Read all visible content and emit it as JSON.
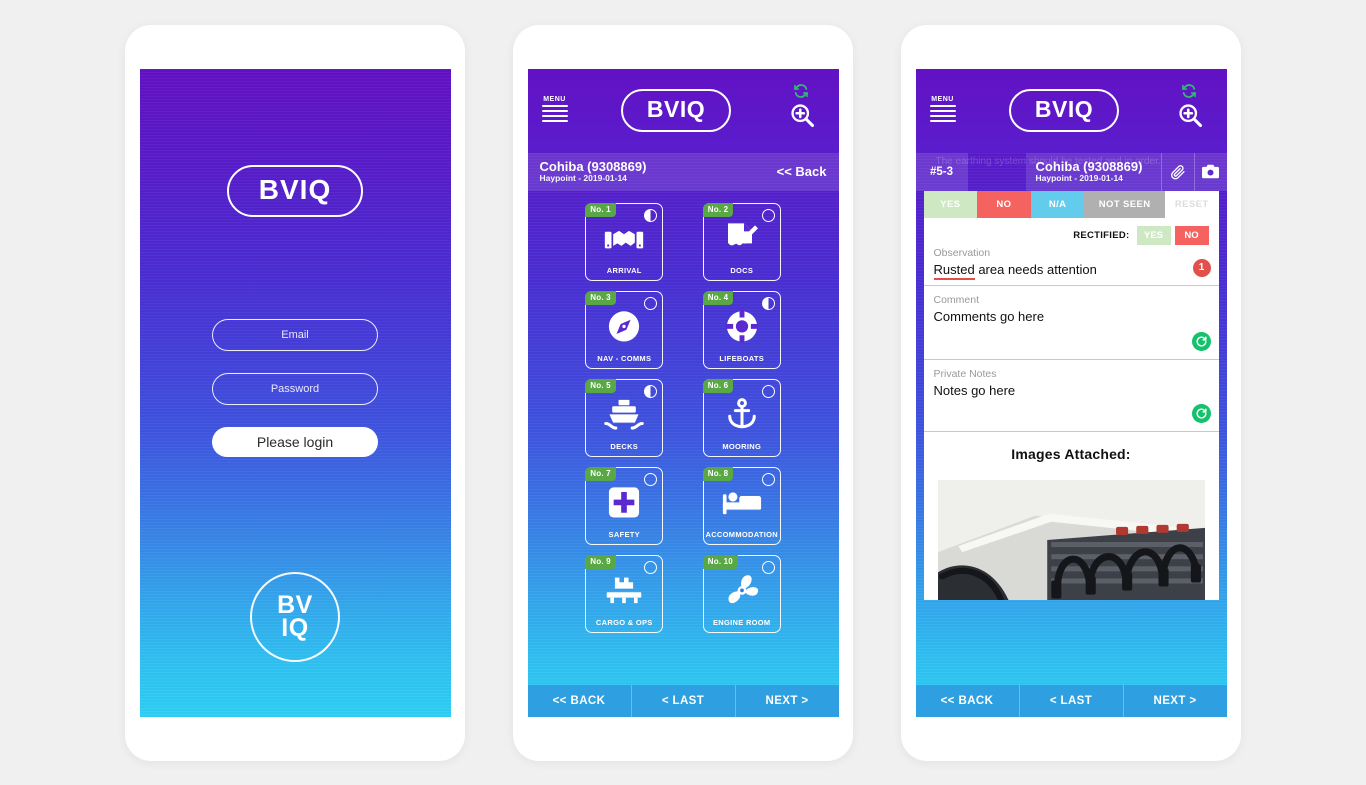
{
  "brand": {
    "wordmark": "BVIQ",
    "circle_line1": "BV",
    "circle_line2": "IQ"
  },
  "login": {
    "email_placeholder": "Email",
    "password_placeholder": "Password",
    "email_value": "",
    "password_value": "",
    "login_button": "Please login"
  },
  "header": {
    "menu_label": "MENU",
    "refresh_icon": "refresh-icon",
    "zoom_icon": "zoom-in-icon"
  },
  "vessel": {
    "name": "Cohiba (9308869)",
    "subtitle": "Haypoint - 2019-01-14",
    "back_label": "<< Back"
  },
  "grid": {
    "tiles": [
      {
        "no": "No. 1",
        "label": "ARRIVAL",
        "status": "half",
        "icon": "handshake-icon"
      },
      {
        "no": "No. 2",
        "label": "DOCS",
        "status": "empty",
        "icon": "document-signature-icon"
      },
      {
        "no": "No. 3",
        "label": "NAV - COMMS",
        "status": "empty",
        "icon": "compass-icon"
      },
      {
        "no": "No. 4",
        "label": "LIFEBOATS",
        "status": "half",
        "icon": "lifebuoy-icon"
      },
      {
        "no": "No. 5",
        "label": "DECKS",
        "status": "half",
        "icon": "ship-icon"
      },
      {
        "no": "No. 6",
        "label": "MOORING",
        "status": "empty",
        "icon": "anchor-icon"
      },
      {
        "no": "No. 7",
        "label": "SAFETY",
        "status": "empty",
        "icon": "first-aid-icon"
      },
      {
        "no": "No. 8",
        "label": "ACCOMMODATION",
        "status": "empty",
        "icon": "bed-icon"
      },
      {
        "no": "No. 9",
        "label": "CARGO & OPS",
        "status": "empty",
        "icon": "cargo-crane-icon"
      },
      {
        "no": "No. 10",
        "label": "ENGINE ROOM",
        "status": "empty",
        "icon": "propeller-icon"
      }
    ]
  },
  "bottom_nav": {
    "back": "<< BACK",
    "last": "< LAST",
    "next": "NEXT >"
  },
  "detail": {
    "item_code": "#5-3",
    "ghost_text": "The earthing system should be tested and in order.",
    "attach_icon": "paperclip-icon",
    "camera_icon": "camera-icon",
    "answers": [
      {
        "label": "YES",
        "state": "unselected"
      },
      {
        "label": "NO",
        "state": "selected"
      },
      {
        "label": "N/A",
        "state": "unselected"
      },
      {
        "label": "NOT SEEN",
        "state": "unselected"
      },
      {
        "label": "RESET",
        "state": "disabled"
      }
    ],
    "rectified_label": "RECTIFIED:",
    "rectified_yes": "YES",
    "rectified_no": "NO",
    "observation_label": "Observation",
    "observation_value_misspelled": "Rusted",
    "observation_value_rest": " area needs attention",
    "observation_count": "1",
    "comment_label": "Comment",
    "comment_value": "Comments go here",
    "notes_label": "Private Notes",
    "notes_value": "Notes go here",
    "images_title": "Images Attached:"
  },
  "colors": {
    "brand_purple": "#6212c4",
    "brand_cyan": "#2fd0f5",
    "tile_green": "#5aa745",
    "answer_no": "#f4635f",
    "answer_yes": "#cde8c2",
    "answer_na": "#63cbec",
    "answer_notseen": "#b0b0b0",
    "grammar_green": "#15c26b",
    "badge_red": "#e2504c",
    "nav_blue": "#2e9fe0",
    "page_bg": "#f0f0f0"
  }
}
